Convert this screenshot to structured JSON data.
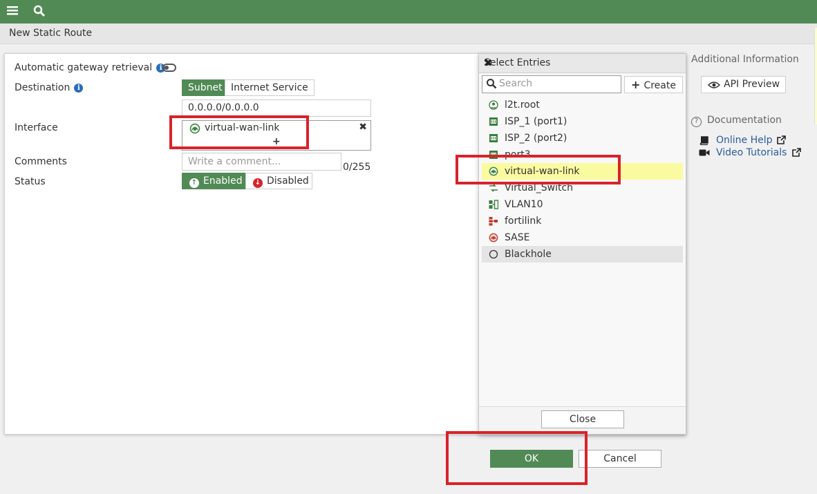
{
  "header": {
    "menu_icon": "menu-icon",
    "search_icon": "search-icon",
    "page_title": "New Static Route"
  },
  "form": {
    "auto_gateway_label": "Automatic gateway retrieval",
    "destination_label": "Destination",
    "dest_tab_subnet": "Subnet",
    "dest_tab_internet": "Internet Service",
    "destination_value": "0.0.0.0/0.0.0.0",
    "interface_label": "Interface",
    "interface_value": "virtual-wan-link",
    "interface_add": "+",
    "interface_remove": "✖",
    "comments_label": "Comments",
    "comments_placeholder": "Write a comment...",
    "comments_counter": "0/255",
    "status_label": "Status",
    "status_enabled": "Enabled",
    "status_disabled": "Disabled",
    "ok_label": "OK",
    "cancel_label": "Cancel"
  },
  "select_entries": {
    "title": "Select Entries",
    "close_x": "✖",
    "search_placeholder": "Search",
    "create_label": "Create",
    "items": [
      {
        "label": "l2t.root",
        "icon": "tunnel-icon"
      },
      {
        "label": "ISP_1 (port1)",
        "icon": "port-icon"
      },
      {
        "label": "ISP_2 (port2)",
        "icon": "port-icon"
      },
      {
        "label": "port3",
        "icon": "port-icon"
      },
      {
        "label": "virtual-wan-link",
        "icon": "sdwan-icon"
      },
      {
        "label": "Virtual_Switch",
        "icon": "switch-icon"
      },
      {
        "label": "VLAN10",
        "icon": "vlan-icon"
      },
      {
        "label": "fortilink",
        "icon": "fortilink-icon"
      },
      {
        "label": "SASE",
        "icon": "sase-icon"
      },
      {
        "label": "Blackhole",
        "icon": "blackhole-icon"
      }
    ],
    "close_label": "Close"
  },
  "sidebar": {
    "additional_info": "Additional Information",
    "api_preview": "API Preview",
    "documentation": "Documentation",
    "online_help": "Online Help",
    "video_tutorials": "Video Tutorials"
  },
  "colors": {
    "brand_green": "#518a55",
    "highlight_red": "#d8232a",
    "selection_yellow": "#fafaa0",
    "link_blue": "#2a5c9a"
  }
}
